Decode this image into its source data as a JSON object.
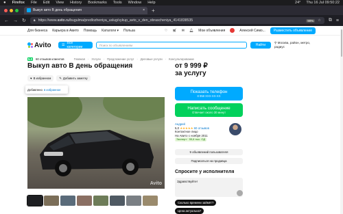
{
  "menubar": {
    "apple": "",
    "items": [
      "Firefox",
      "File",
      "Edit",
      "View",
      "History",
      "Bookmarks",
      "Tools",
      "Window",
      "Help"
    ],
    "temp": "24°",
    "clock": "Thu 16 Jul 09:50:22"
  },
  "tab": {
    "title": "Выкуп авто В день обращения",
    "close": "×"
  },
  "newtab": "+",
  "urlbar": {
    "prefix": "https://www.",
    "domain": "avito.ru",
    "path": "/bugulma/predlozheniya_uslug/vykup_avto_v_den_obrascheniya_4141838535",
    "zoom": "90%"
  },
  "topnav": {
    "links": [
      "Для бизнеса",
      "Карьера в Авито",
      "Помощь",
      "Каталоги ▾",
      "Польза"
    ],
    "messages": "Мои объявления",
    "user": "Алексей Симо...",
    "post_button": "Разместить объявление"
  },
  "header": {
    "logo": "Avito",
    "categories_button": "Все категории",
    "search_placeholder": "Поиск по объявлениям",
    "search_button": "Найти",
    "location": "Москва, район, метро, радиус"
  },
  "breadcrumbs": {
    "rating": "5.0",
    "reviews": "60 отзывов клиентов",
    "items": [
      "Главная",
      "Услуги",
      "Предложение услуг",
      "Деловые услуги",
      "Консультирование"
    ]
  },
  "listing": {
    "title": "Выкуп авто В день обращения",
    "fav_label": "В избранном",
    "note_label": "Добавить заметку",
    "toast_text": "Добавлено",
    "toast_link": "в избранное",
    "watermark": "Avito",
    "price_line1": "от 9 999 ₽",
    "price_line2": "за услугу"
  },
  "contact": {
    "phone_title": "Показать телефон",
    "phone_sub": "8 958 XXX-XX-XX",
    "message_title": "Написать сообщение",
    "message_sub": "Отвечает около 30 минут"
  },
  "seller": {
    "name": "Андрей",
    "rating": "5,0",
    "stars": "★★★★★",
    "reviews": "60 отзывов",
    "type": "Контактное лицо",
    "since": "На Авито с ноября 2011",
    "badge": "Эксперт · 55,6 тыс. ОД",
    "listings_button": "9 объявлений пользователя",
    "subscribe_button": "Подписаться на продавца"
  },
  "ask": {
    "title": "Спросите у исполнителя",
    "greeting": "Здравствуйте!",
    "chip1": "Сколько времени займёт?",
    "chip2": "Цена актуальна?"
  },
  "colors": {
    "accent": "#00aaff",
    "green": "#02d15c",
    "phone_btn": "#00aaff",
    "message_btn": "#02d15c"
  }
}
